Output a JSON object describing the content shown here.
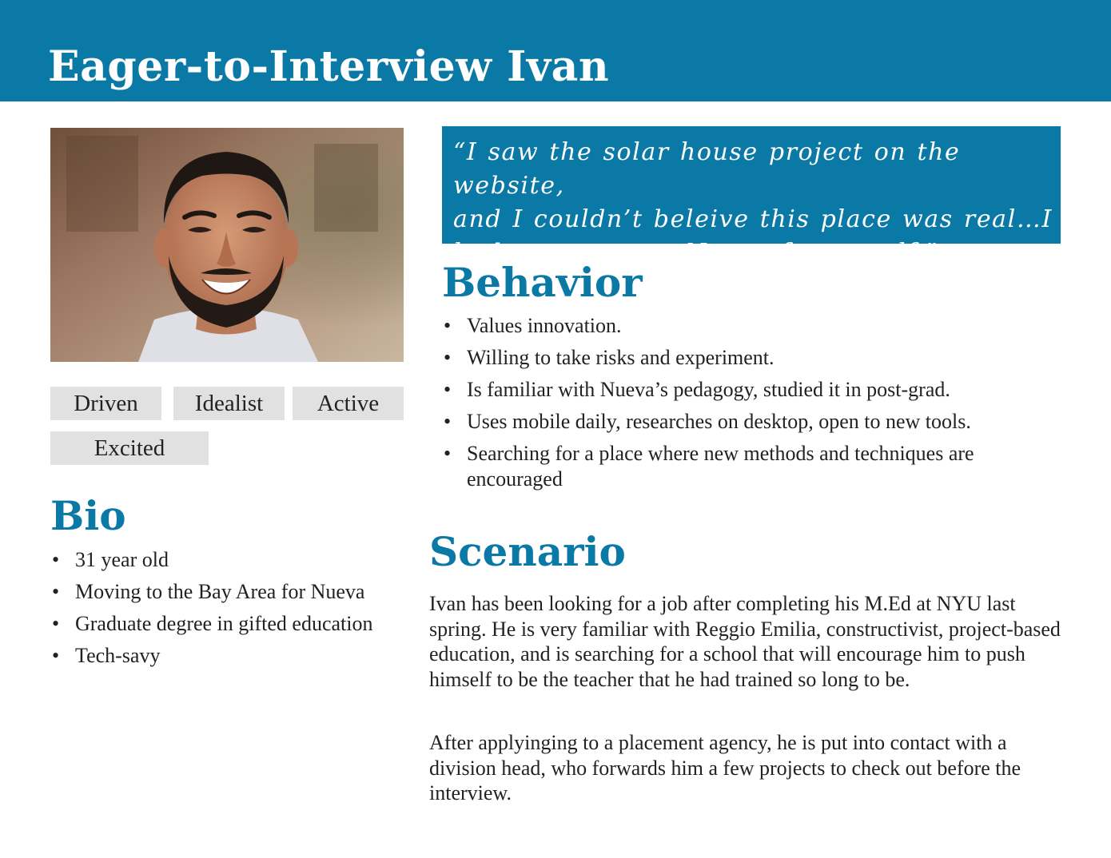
{
  "header": {
    "title": "Eager-to-Interview Ivan",
    "background_color": "#0a79a6",
    "text_color": "#ffffff"
  },
  "photo": {
    "description_icon": "portrait-photo"
  },
  "traits": [
    "Driven",
    "Idealist",
    "Active",
    "Excited"
  ],
  "quote": {
    "text": "“I saw the solar house project on the website,\nand I couldn’t beleive this place was real…I\nhad to come see Nueva for myself.”"
  },
  "behavior": {
    "heading": "Behavior",
    "items": [
      "Values innovation.",
      "Willing to take risks and experiment.",
      "Is familiar with Nueva’s pedagogy, studied it in post-grad.",
      "Uses mobile daily, researches on desktop, open to new tools.",
      "Searching for a place where new methods and techniques are encouraged"
    ]
  },
  "bio": {
    "heading": "Bio",
    "items": [
      "31 year old",
      "Moving to the Bay Area for Nueva",
      "Graduate degree in gifted education",
      "Tech-savy"
    ]
  },
  "scenario": {
    "heading": "Scenario",
    "paragraphs": [
      "Ivan has been looking for a job after completing his M.Ed at NYU last spring.  He is very familiar with Reggio Emilia, constructivist, project-based education, and is searching for a school that will encourage him to push himself to be the teacher that he had trained so long to be.",
      "After applyinging to a placement agency, he is put into contact with a division head, who forwards him a few projects to check out before the interview."
    ]
  },
  "colors": {
    "accent": "#0a79a6",
    "trait_background": "#e1e1e1",
    "body_text": "#222222"
  }
}
